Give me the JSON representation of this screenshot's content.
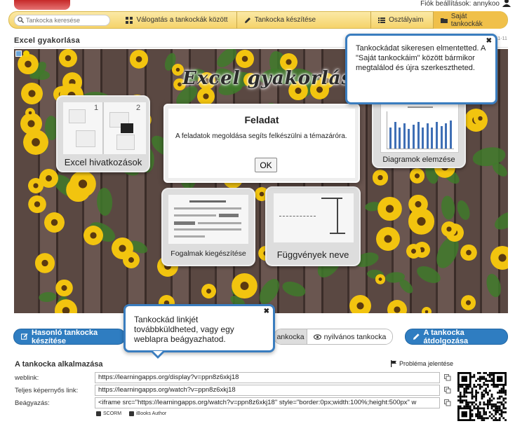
{
  "header": {
    "account_text": "Fiók beállítások: annykoo"
  },
  "nav": {
    "search_placeholder": "Tankocka keresése",
    "items": [
      {
        "label": "Válogatás a tankockák között",
        "icon": "grid-icon"
      },
      {
        "label": "Tankocka készítése",
        "icon": "pencil-icon"
      },
      {
        "label": "Osztályaim",
        "icon": "list-icon"
      },
      {
        "label": "Saját tankockák",
        "icon": "folder-icon"
      }
    ]
  },
  "page": {
    "title": "Excel gyakorlása",
    "date_fragment": "11-11"
  },
  "stage": {
    "title": "Excel gyakorlása",
    "tiles": [
      {
        "label": "Excel hivatkozások",
        "num1": "1",
        "num2": "2"
      },
      {
        "label": "Diagramok elemzése"
      },
      {
        "label": "Fogalmak kiegészítése"
      },
      {
        "label": "Függvények neve"
      }
    ],
    "dialog": {
      "title": "Feladat",
      "text": "A feladatok megoldása segíts felkészülni a témazáróra.",
      "ok_label": "OK"
    }
  },
  "tooltips": {
    "saved": "Tankockádat sikeresen elmentetted. A \"Saját tankockáim\" között bármikor megtalálod és újra szerkesztheted.",
    "link": "Tankockád linkjét továbbküldheted, vagy egy weblapra beágyazhatod.",
    "close_symbol": "✖"
  },
  "actions": {
    "similar_label": "Hasonló tankocka készítése",
    "seg_private": "ankocka",
    "seg_public": "nyilvános tankocka",
    "rework_label": "A tankocka átdolgozása"
  },
  "usage": {
    "title": "A tankocka alkalmazása",
    "report_label": "Probléma jelentése",
    "fields": [
      {
        "label": "weblink:",
        "value": "https://learningapps.org/display?v=ppn8z6xkj18"
      },
      {
        "label": "Teljes képernyős link:",
        "value": "https://learningapps.org/watch?v=ppn8z6xkj18"
      },
      {
        "label": "Beágyazás:",
        "value": "<iframe src=\"https://learningapps.org/watch?v=ppn8z6xkj18\" style=\"border:0px;width:100%;height:500px\" w"
      }
    ],
    "scorm_label": "SCORM",
    "ibooks_label": "iBooks Author"
  },
  "colors": {
    "nav_bg": "#f5d36a",
    "accent_blue": "#2f7dc1",
    "tooltip_border": "#3a7dbf"
  }
}
